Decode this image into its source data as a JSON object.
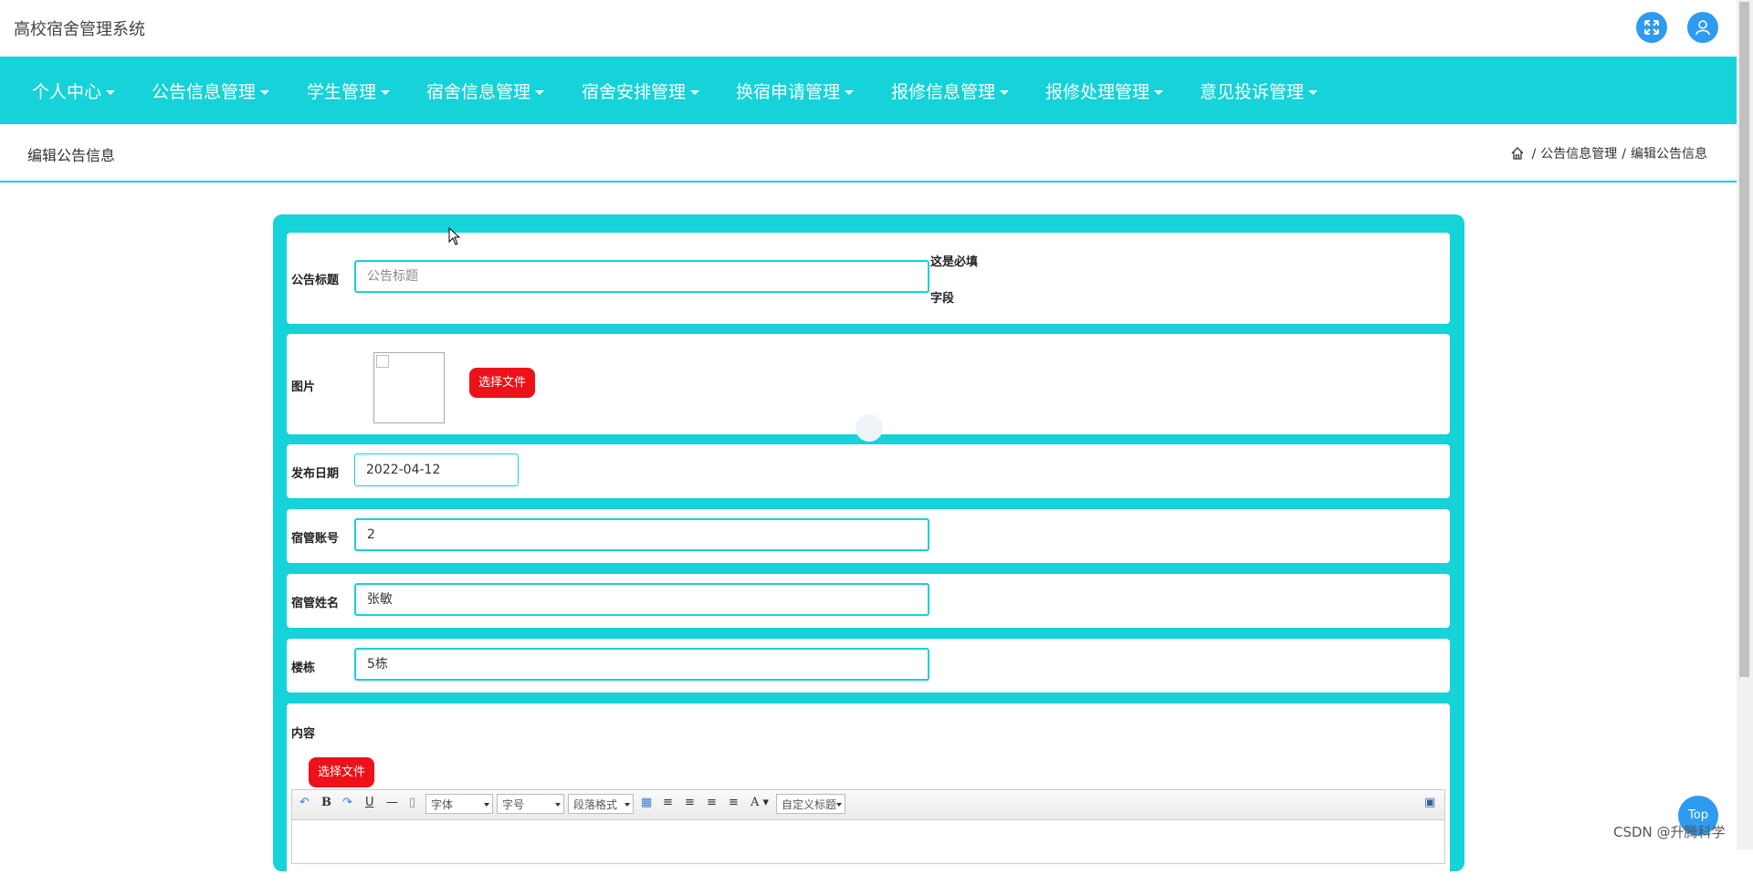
{
  "app": {
    "title": "高校宿舍管理系统"
  },
  "topbar": {
    "icons": [
      "fullscreen-icon",
      "user-icon"
    ]
  },
  "nav": {
    "items": [
      {
        "label": "个人中心"
      },
      {
        "label": "公告信息管理"
      },
      {
        "label": "学生管理"
      },
      {
        "label": "宿舍信息管理"
      },
      {
        "label": "宿舍安排管理"
      },
      {
        "label": "换宿申请管理"
      },
      {
        "label": "报修信息管理"
      },
      {
        "label": "报修处理管理"
      },
      {
        "label": "意见投诉管理"
      }
    ]
  },
  "page": {
    "title": "编辑公告信息",
    "breadcrumb": [
      "公告信息管理",
      "编辑公告信息"
    ]
  },
  "form": {
    "title_label": "公告标题",
    "title_placeholder": "公告标题",
    "title_value": "",
    "required_line1": "这是必填",
    "required_line2": "字段",
    "image_label": "图片",
    "choose_file": "选择文件",
    "date_label": "发布日期",
    "date_value": "2022-04-12",
    "account_label": "宿管账号",
    "account_value": "2",
    "name_label": "宿管姓名",
    "name_value": "张敏",
    "building_label": "楼栋",
    "building_value": "5栋",
    "content_label": "内容",
    "content_choose_file": "选择文件"
  },
  "editor": {
    "bold": "B",
    "underline": "U",
    "font_select": "字体",
    "size_select": "字号",
    "paragraph_select": "段落格式",
    "font_color": "A",
    "custom_title_select": "自定义标题"
  },
  "misc": {
    "top_button": "Top",
    "watermark": "CSDN @升腾科学"
  },
  "colors": {
    "accent": "#16d2d9",
    "danger": "#ee1119",
    "icon_blue": "#2e9bf0"
  }
}
